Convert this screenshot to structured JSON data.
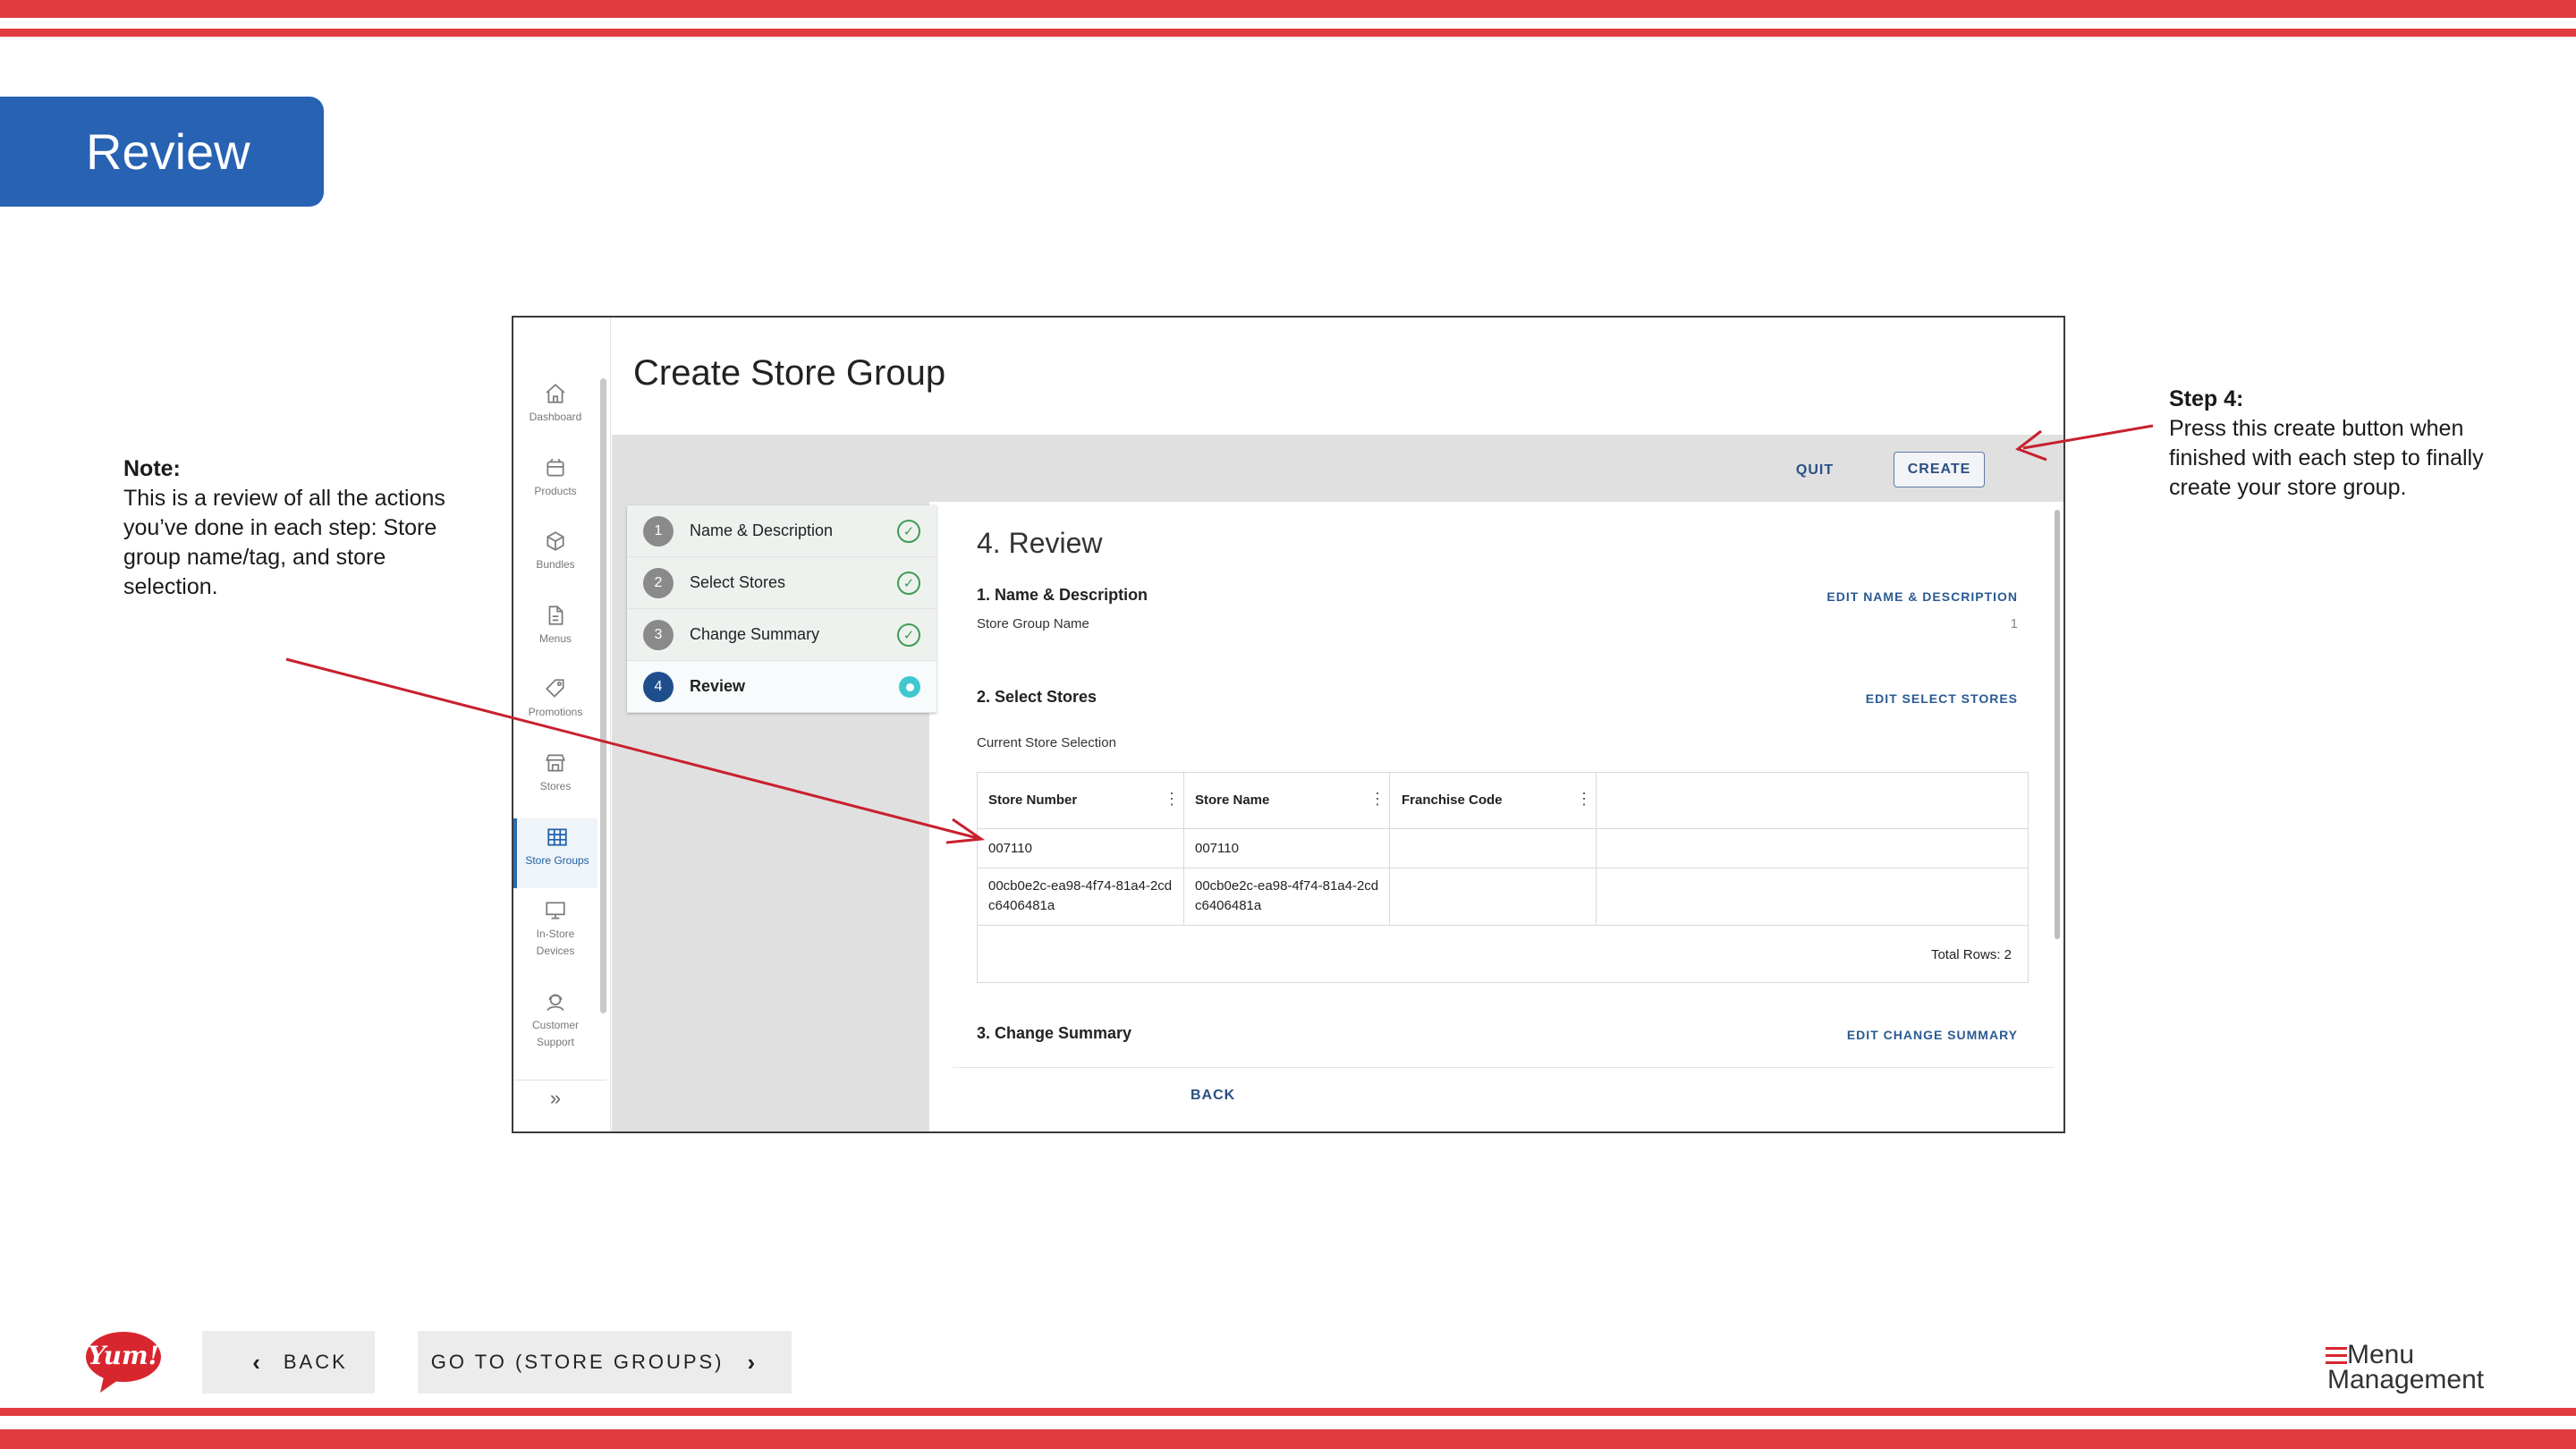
{
  "slide": {
    "title": "Review",
    "note_heading": "Note:",
    "note_text": "This is a review of all the actions you’ve done in each step: Store group name/tag, and store selection.",
    "step_heading": "Step 4:",
    "step_text": "Press this create button when finished with each step to finally create your store group."
  },
  "sidebar": {
    "items": [
      {
        "label": "Dashboard",
        "icon": "home-icon"
      },
      {
        "label": "Products",
        "icon": "box-icon"
      },
      {
        "label": "Bundles",
        "icon": "cube-icon"
      },
      {
        "label": "Menus",
        "icon": "document-icon"
      },
      {
        "label": "Promotions",
        "icon": "tag-icon"
      },
      {
        "label": "Stores",
        "icon": "storefront-icon"
      },
      {
        "label": "Store Groups",
        "icon": "grid-icon"
      },
      {
        "label": "In-Store Devices",
        "icon": "monitor-icon"
      },
      {
        "label": "Customer Support",
        "icon": "headset-icon"
      }
    ]
  },
  "page": {
    "title": "Create Store Group",
    "quit_label": "QUIT",
    "create_label": "CREATE",
    "back_label": "BACK"
  },
  "stepper": {
    "steps": [
      {
        "num": "1",
        "label": "Name & Description",
        "status": "complete"
      },
      {
        "num": "2",
        "label": "Select Stores",
        "status": "complete"
      },
      {
        "num": "3",
        "label": "Change Summary",
        "status": "complete"
      },
      {
        "num": "4",
        "label": "Review",
        "status": "current"
      }
    ]
  },
  "review": {
    "title": "4. Review",
    "section1": {
      "heading": "1. Name & Description",
      "edit": "EDIT NAME & DESCRIPTION",
      "field_label": "Store Group Name",
      "field_value": "1"
    },
    "section2": {
      "heading": "2. Select Stores",
      "edit": "EDIT SELECT STORES",
      "subheading": "Current Store Selection",
      "columns": [
        "Store Number",
        "Store Name",
        "Franchise Code"
      ],
      "rows": [
        [
          "007110",
          "007110",
          ""
        ],
        [
          "00cb0e2c-ea98-4f74-81a4-2cdc6406481a",
          "00cb0e2c-ea98-4f74-81a4-2cdc6406481a",
          ""
        ]
      ],
      "total": "Total Rows: 2"
    },
    "section3": {
      "heading": "3. Change Summary",
      "edit": "EDIT CHANGE SUMMARY"
    }
  },
  "bottom_nav": {
    "back_label": "BACK",
    "goto_label": "GO TO (STORE GROUPS)",
    "yum_logo": "Yum!",
    "menu_logo_line1": "Menu",
    "menu_logo_line2": "Management"
  },
  "colors": {
    "stripe": "#e03c40",
    "badge": "#2762b3",
    "arrow": "#c8202e",
    "link": "#2a4f82"
  }
}
